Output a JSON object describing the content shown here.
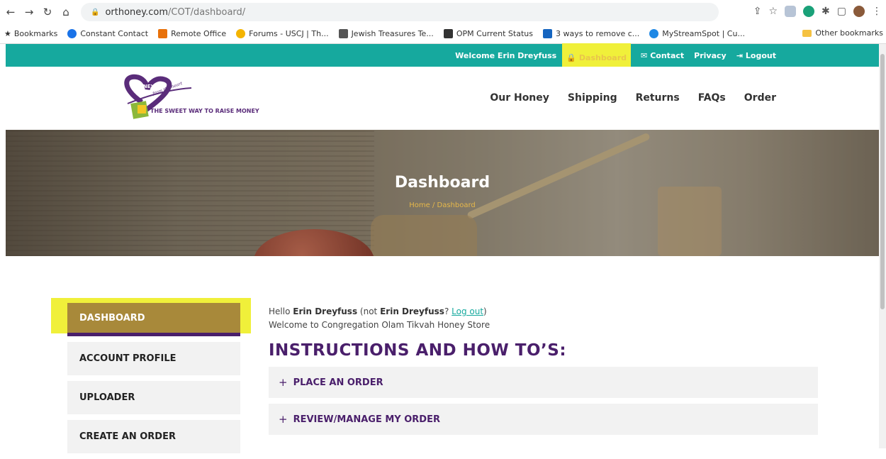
{
  "browser": {
    "url_domain": "orthoney.com",
    "url_path": "/COT/dashboard/",
    "bookmarks": [
      {
        "label": "Bookmarks",
        "color": "#444"
      },
      {
        "label": "Constant Contact",
        "color": "#1a73e8"
      },
      {
        "label": "Remote Office",
        "color": "#e8710a"
      },
      {
        "label": "Forums - USCJ | Th...",
        "color": "#f4b400"
      },
      {
        "label": "Jewish Treasures Te...",
        "color": "#555"
      },
      {
        "label": "OPM Current Status",
        "color": "#333"
      },
      {
        "label": "3 ways to remove c...",
        "color": "#1565c0"
      },
      {
        "label": "MyStreamSpot | Cu...",
        "color": "#1e88e5"
      }
    ],
    "other_bookmarks": "Other bookmarks"
  },
  "topbar": {
    "welcome": "Welcome Erin Dreyfuss",
    "dashboard": "Dashboard",
    "contact": "Contact",
    "privacy": "Privacy",
    "logout": "Logout"
  },
  "logo": {
    "tagline": "THE SWEET WAY TO RAISE MONEY",
    "mark_word": "HONEY",
    "mark_script": "from the heart"
  },
  "nav": [
    "Our Honey",
    "Shipping",
    "Returns",
    "FAQs",
    "Order"
  ],
  "hero": {
    "title": "Dashboard",
    "crumb_home": "Home",
    "crumb_sep": "/",
    "crumb_current": "Dashboard"
  },
  "sidebar": [
    "DASHBOARD",
    "ACCOUNT PROFILE",
    "UPLOADER",
    "CREATE AN ORDER"
  ],
  "main": {
    "hello": "Hello",
    "name": "Erin Dreyfuss",
    "not": "(not",
    "name2": "Erin Dreyfuss",
    "q": "?",
    "logout_link": "Log out",
    "close": ")",
    "welcome": "Welcome to Congregation Olam Tikvah Honey Store",
    "heading": "INSTRUCTIONS AND HOW TO’S:",
    "accordions": [
      "PLACE AN ORDER",
      "REVIEW/MANAGE MY ORDER"
    ]
  },
  "colors": {
    "teal": "#16a99e",
    "purple": "#4a1f6b",
    "gold": "#a8893a",
    "highlight": "#f0f03a"
  }
}
